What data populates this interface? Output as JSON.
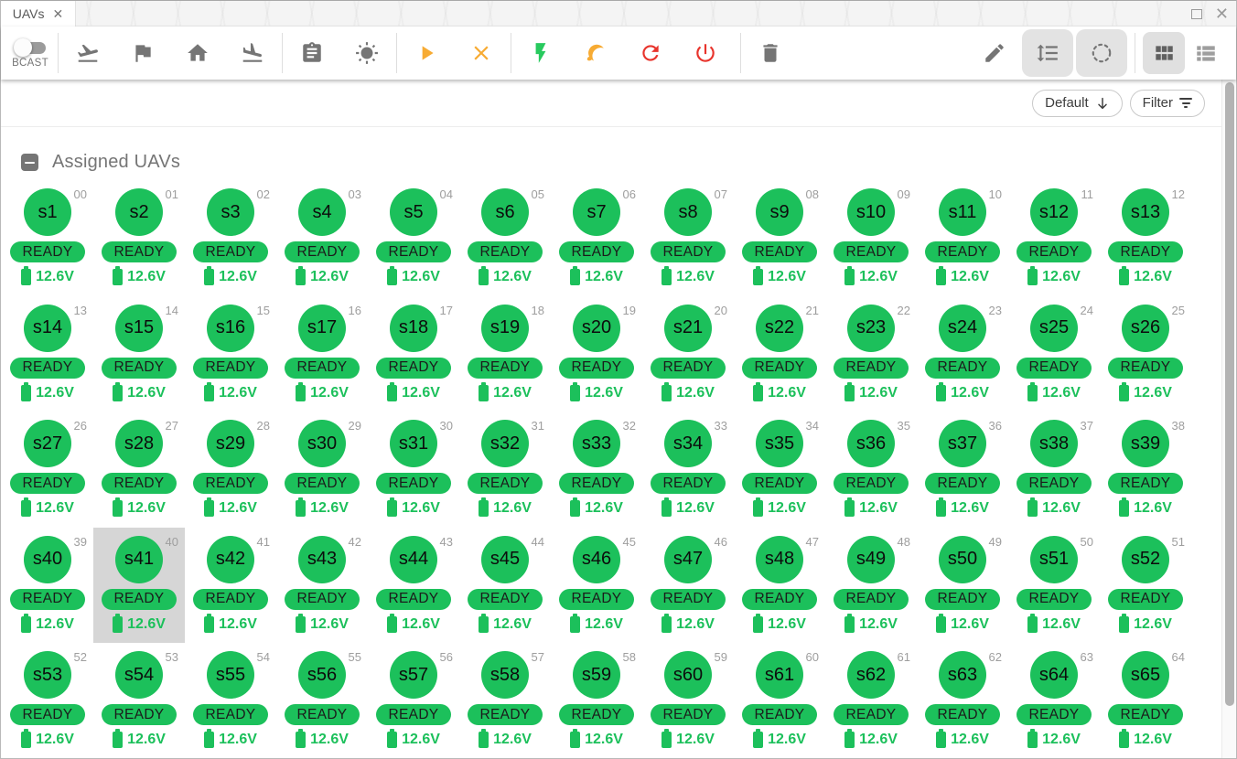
{
  "colors": {
    "uav_green": "#1cc05b",
    "warning_amber": "#f7ab33",
    "success_green": "#28ca5e",
    "danger_red": "#e8342c",
    "selected_bg": "#d6d6d6",
    "icon_gray": "#757575"
  },
  "window": {
    "tab_label": "UAVs",
    "tab_close": "✕",
    "maximize_icon": "maximize",
    "close_icon": "✕"
  },
  "toolbar": {
    "broadcast_label": "BCAST",
    "broadcast_state": "off",
    "icons": [
      "flight-takeoff-icon",
      "flag-icon",
      "home-icon",
      "flight-land-icon",
      "mission-clipboard-icon",
      "lights-sun-icon",
      "start-play-icon",
      "cancel-x-icon",
      "arm-flash-icon",
      "sleep-moon-icon",
      "reboot-refresh-icon",
      "power-off-icon",
      "remove-trash-icon",
      "edit-pencil-icon",
      "sort-order-icon",
      "selection-dashed-circle-icon",
      "grid-view-icon",
      "list-view-icon"
    ],
    "active_view": "grid"
  },
  "filter_bar": {
    "preset_label": "Default",
    "filter_label": "Filter"
  },
  "section": {
    "title": "Assigned UAVs"
  },
  "uavs": {
    "selected_id": "s41",
    "items": [
      {
        "id": "s1",
        "index": "00",
        "status": "READY",
        "voltage": "12.6V"
      },
      {
        "id": "s2",
        "index": "01",
        "status": "READY",
        "voltage": "12.6V"
      },
      {
        "id": "s3",
        "index": "02",
        "status": "READY",
        "voltage": "12.6V"
      },
      {
        "id": "s4",
        "index": "03",
        "status": "READY",
        "voltage": "12.6V"
      },
      {
        "id": "s5",
        "index": "04",
        "status": "READY",
        "voltage": "12.6V"
      },
      {
        "id": "s6",
        "index": "05",
        "status": "READY",
        "voltage": "12.6V"
      },
      {
        "id": "s7",
        "index": "06",
        "status": "READY",
        "voltage": "12.6V"
      },
      {
        "id": "s8",
        "index": "07",
        "status": "READY",
        "voltage": "12.6V"
      },
      {
        "id": "s9",
        "index": "08",
        "status": "READY",
        "voltage": "12.6V"
      },
      {
        "id": "s10",
        "index": "09",
        "status": "READY",
        "voltage": "12.6V"
      },
      {
        "id": "s11",
        "index": "10",
        "status": "READY",
        "voltage": "12.6V"
      },
      {
        "id": "s12",
        "index": "11",
        "status": "READY",
        "voltage": "12.6V"
      },
      {
        "id": "s13",
        "index": "12",
        "status": "READY",
        "voltage": "12.6V"
      },
      {
        "id": "s14",
        "index": "13",
        "status": "READY",
        "voltage": "12.6V"
      },
      {
        "id": "s15",
        "index": "14",
        "status": "READY",
        "voltage": "12.6V"
      },
      {
        "id": "s16",
        "index": "15",
        "status": "READY",
        "voltage": "12.6V"
      },
      {
        "id": "s17",
        "index": "16",
        "status": "READY",
        "voltage": "12.6V"
      },
      {
        "id": "s18",
        "index": "17",
        "status": "READY",
        "voltage": "12.6V"
      },
      {
        "id": "s19",
        "index": "18",
        "status": "READY",
        "voltage": "12.6V"
      },
      {
        "id": "s20",
        "index": "19",
        "status": "READY",
        "voltage": "12.6V"
      },
      {
        "id": "s21",
        "index": "20",
        "status": "READY",
        "voltage": "12.6V"
      },
      {
        "id": "s22",
        "index": "21",
        "status": "READY",
        "voltage": "12.6V"
      },
      {
        "id": "s23",
        "index": "22",
        "status": "READY",
        "voltage": "12.6V"
      },
      {
        "id": "s24",
        "index": "23",
        "status": "READY",
        "voltage": "12.6V"
      },
      {
        "id": "s25",
        "index": "24",
        "status": "READY",
        "voltage": "12.6V"
      },
      {
        "id": "s26",
        "index": "25",
        "status": "READY",
        "voltage": "12.6V"
      },
      {
        "id": "s27",
        "index": "26",
        "status": "READY",
        "voltage": "12.6V"
      },
      {
        "id": "s28",
        "index": "27",
        "status": "READY",
        "voltage": "12.6V"
      },
      {
        "id": "s29",
        "index": "28",
        "status": "READY",
        "voltage": "12.6V"
      },
      {
        "id": "s30",
        "index": "29",
        "status": "READY",
        "voltage": "12.6V"
      },
      {
        "id": "s31",
        "index": "30",
        "status": "READY",
        "voltage": "12.6V"
      },
      {
        "id": "s32",
        "index": "31",
        "status": "READY",
        "voltage": "12.6V"
      },
      {
        "id": "s33",
        "index": "32",
        "status": "READY",
        "voltage": "12.6V"
      },
      {
        "id": "s34",
        "index": "33",
        "status": "READY",
        "voltage": "12.6V"
      },
      {
        "id": "s35",
        "index": "34",
        "status": "READY",
        "voltage": "12.6V"
      },
      {
        "id": "s36",
        "index": "35",
        "status": "READY",
        "voltage": "12.6V"
      },
      {
        "id": "s37",
        "index": "36",
        "status": "READY",
        "voltage": "12.6V"
      },
      {
        "id": "s38",
        "index": "37",
        "status": "READY",
        "voltage": "12.6V"
      },
      {
        "id": "s39",
        "index": "38",
        "status": "READY",
        "voltage": "12.6V"
      },
      {
        "id": "s40",
        "index": "39",
        "status": "READY",
        "voltage": "12.6V"
      },
      {
        "id": "s41",
        "index": "40",
        "status": "READY",
        "voltage": "12.6V",
        "selected": true
      },
      {
        "id": "s42",
        "index": "41",
        "status": "READY",
        "voltage": "12.6V"
      },
      {
        "id": "s43",
        "index": "42",
        "status": "READY",
        "voltage": "12.6V"
      },
      {
        "id": "s44",
        "index": "43",
        "status": "READY",
        "voltage": "12.6V"
      },
      {
        "id": "s45",
        "index": "44",
        "status": "READY",
        "voltage": "12.6V"
      },
      {
        "id": "s46",
        "index": "45",
        "status": "READY",
        "voltage": "12.6V"
      },
      {
        "id": "s47",
        "index": "46",
        "status": "READY",
        "voltage": "12.6V"
      },
      {
        "id": "s48",
        "index": "47",
        "status": "READY",
        "voltage": "12.6V"
      },
      {
        "id": "s49",
        "index": "48",
        "status": "READY",
        "voltage": "12.6V"
      },
      {
        "id": "s50",
        "index": "49",
        "status": "READY",
        "voltage": "12.6V"
      },
      {
        "id": "s51",
        "index": "50",
        "status": "READY",
        "voltage": "12.6V"
      },
      {
        "id": "s52",
        "index": "51",
        "status": "READY",
        "voltage": "12.6V"
      },
      {
        "id": "s53",
        "index": "52",
        "status": "READY",
        "voltage": "12.6V"
      },
      {
        "id": "s54",
        "index": "53",
        "status": "READY",
        "voltage": "12.6V"
      },
      {
        "id": "s55",
        "index": "54",
        "status": "READY",
        "voltage": "12.6V"
      },
      {
        "id": "s56",
        "index": "55",
        "status": "READY",
        "voltage": "12.6V"
      },
      {
        "id": "s57",
        "index": "56",
        "status": "READY",
        "voltage": "12.6V"
      },
      {
        "id": "s58",
        "index": "57",
        "status": "READY",
        "voltage": "12.6V"
      },
      {
        "id": "s59",
        "index": "58",
        "status": "READY",
        "voltage": "12.6V"
      },
      {
        "id": "s60",
        "index": "59",
        "status": "READY",
        "voltage": "12.6V"
      },
      {
        "id": "s61",
        "index": "60",
        "status": "READY",
        "voltage": "12.6V"
      },
      {
        "id": "s62",
        "index": "61",
        "status": "READY",
        "voltage": "12.6V"
      },
      {
        "id": "s63",
        "index": "62",
        "status": "READY",
        "voltage": "12.6V"
      },
      {
        "id": "s64",
        "index": "63",
        "status": "READY",
        "voltage": "12.6V"
      },
      {
        "id": "s65",
        "index": "64",
        "status": "READY",
        "voltage": "12.6V"
      }
    ]
  }
}
